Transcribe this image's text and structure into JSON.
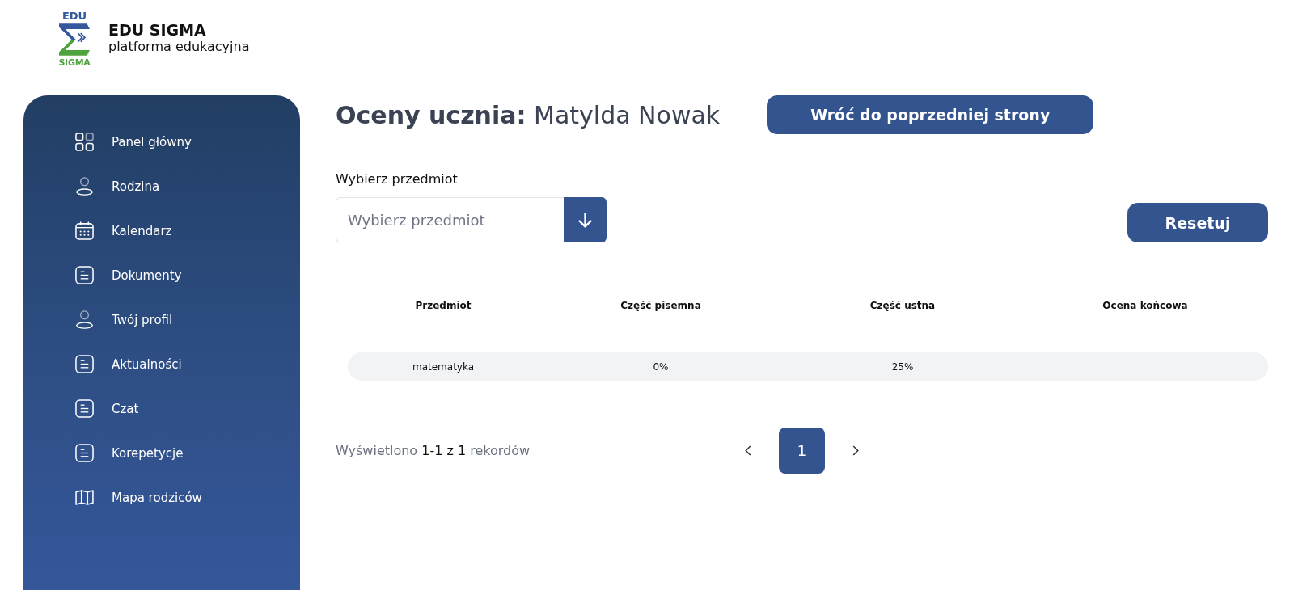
{
  "logo": {
    "top_text": "EDU",
    "bottom_text": "SIGMA"
  },
  "brand": {
    "title": "EDU SIGMA",
    "subtitle": "platforma edukacyjna"
  },
  "sidebar": {
    "items": [
      {
        "label": "Panel główny",
        "kind": "grid",
        "selected": false
      },
      {
        "label": "Rodzina",
        "kind": "person",
        "selected": false
      },
      {
        "label": "Kalendarz",
        "kind": "calendar",
        "selected": false
      },
      {
        "label": "Dokumenty",
        "kind": "document",
        "selected": false
      },
      {
        "label": "Twój profil",
        "kind": "person",
        "selected": false
      },
      {
        "label": "Aktualności",
        "kind": "document",
        "selected": false
      },
      {
        "label": "Czat",
        "kind": "document",
        "selected": false
      },
      {
        "label": "Korepetycje",
        "kind": "document",
        "selected": false
      },
      {
        "label": "Mapa rodziców",
        "kind": "map",
        "selected": false
      }
    ]
  },
  "page": {
    "title": "**Oceny ucznia:** Matylda Nowak",
    "back_button": "Wróć do poprzedniej strony"
  },
  "filter": {
    "label": "Wybierz przedmiot",
    "placeholder": "Wybierz przedmiot",
    "reset_button": "Resetuj"
  },
  "table": {
    "columns": [
      "Przedmiot",
      "Część pisemna",
      "Część ustna",
      "Ocena końcowa"
    ],
    "rows": [
      {
        "cells": [
          "matematyka",
          "0%",
          "25%"
        ]
      }
    ]
  },
  "pagination": {
    "summary": "Wyświetlono **1-1 z 1** rekordów",
    "pages": [
      {
        "label": "1",
        "selected": true
      }
    ]
  }
}
